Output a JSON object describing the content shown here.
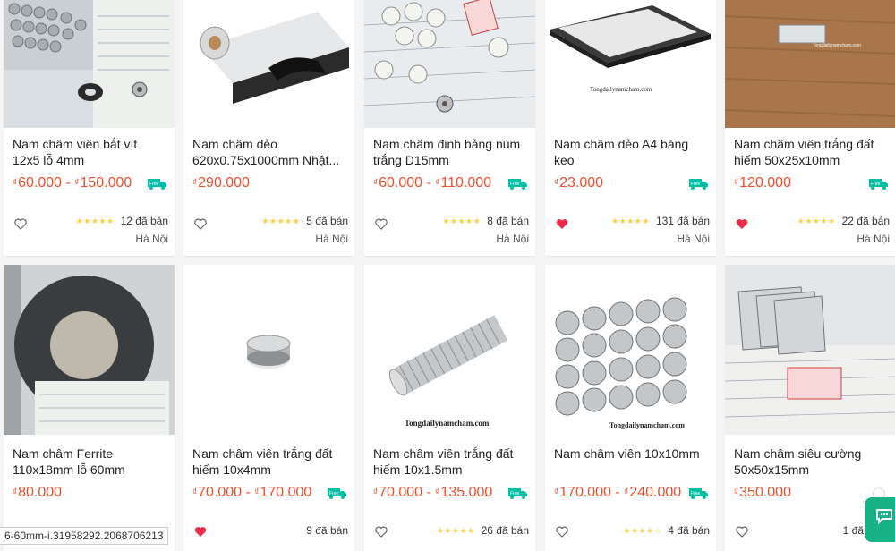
{
  "products": [
    {
      "name": "Nam châm viên bắt vít 12x5 lỗ 4mm",
      "price": "60.000 - ",
      "price2": "150.000",
      "rating": 5,
      "sold": "12 đã bán",
      "location": "Hà Nội",
      "liked": false,
      "image": "magnet-screws-photo"
    },
    {
      "name": "Nam châm dẻo 620x0.75x1000mm Nhật...",
      "price": "290.000",
      "price2": "",
      "rating": 5,
      "sold": "5 đã bán",
      "location": "Hà Nội",
      "liked": false,
      "image": "flexible-magnet-roll-photo"
    },
    {
      "name": "Nam châm đinh bảng núm trắng D15mm",
      "price": "60.000 - ",
      "price2": "110.000",
      "rating": 5,
      "sold": "8 đã bán",
      "location": "Hà Nội",
      "liked": false,
      "image": "white-knob-magnets-photo"
    },
    {
      "name": "Nam châm dẻo A4 băng keo",
      "price": "23.000",
      "price2": "",
      "rating": 5,
      "sold": "131 đã bán",
      "location": "Hà Nội",
      "liked": true,
      "image": "a4-magnet-sheets-photo"
    },
    {
      "name": "Nam châm viên trắng đất hiếm 50x25x10mm",
      "price": "120.000",
      "price2": "",
      "rating": 5,
      "sold": "22 đã bán",
      "location": "Hà Nội",
      "liked": true,
      "image": "block-magnet-photo"
    },
    {
      "name": "Nam châm Ferrite 110x18mm lỗ 60mm",
      "price": "80.000",
      "price2": "",
      "rating": 0,
      "sold": "",
      "location": "",
      "liked": false,
      "image": "ferrite-ring-photo"
    },
    {
      "name": "Nam châm viên trắng đất hiếm 10x4mm",
      "price": "70.000 - ",
      "price2": "170.000",
      "rating": 0,
      "sold": "9 đã bán",
      "location": "",
      "liked": true,
      "image": "disc-magnet-photo"
    },
    {
      "name": "Nam châm viên trắng đất hiếm 10x1.5mm",
      "price": "70.000 - ",
      "price2": "135.000",
      "rating": 5,
      "sold": "26 đã bán",
      "location": "",
      "liked": false,
      "image": "stacked-disc-magnets-photo"
    },
    {
      "name": "Nam châm viên 10x10mm",
      "price": "170.000 - ",
      "price2": "240.000",
      "rating": 4,
      "sold": "4 đã bán",
      "location": "",
      "liked": false,
      "image": "cylinder-magnets-photo"
    },
    {
      "name": "Nam châm siêu cường 50x50x15mm",
      "price": "350.000",
      "price2": "",
      "rating": 0,
      "sold": "1 đã",
      "location": "",
      "liked": false,
      "image": "square-magnets-photo"
    }
  ],
  "currency_symbol": "₫",
  "watermark": "Tongdailynamcham.com",
  "free_label": "Free",
  "status_url": "6-60mm-i.31958292.2068706213",
  "colors": {
    "price": "#ee4d2d",
    "star": "#ffce3d",
    "free": "#00bfa5",
    "heart": "#ee2c4a",
    "chat": "#17b387"
  }
}
